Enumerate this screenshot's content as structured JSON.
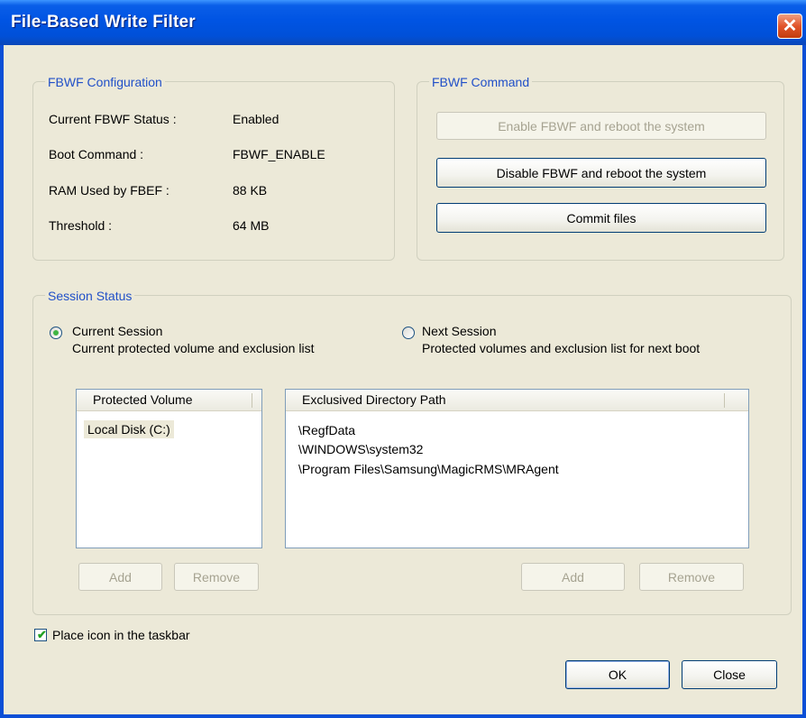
{
  "window": {
    "title": "File-Based Write Filter",
    "close_glyph": "✕"
  },
  "config": {
    "legend": "FBWF Configuration",
    "rows": [
      {
        "label": "Current FBWF Status :",
        "value": "Enabled"
      },
      {
        "label": "Boot Command :",
        "value": "FBWF_ENABLE"
      },
      {
        "label": "RAM Used by FBEF :",
        "value": "88 KB"
      },
      {
        "label": "Threshold :",
        "value": "64 MB"
      }
    ]
  },
  "command": {
    "legend": "FBWF Command",
    "enable_label": "Enable FBWF and reboot the system",
    "disable_label": "Disable FBWF and reboot the system",
    "commit_label": "Commit files"
  },
  "session": {
    "legend": "Session Status",
    "current": {
      "title": "Current Session",
      "desc": "Current  protected volume and exclusion list",
      "selected": true
    },
    "next": {
      "title": "Next Session",
      "desc": "Protected volumes and exclusion list for next boot",
      "selected": false
    },
    "volumes": {
      "header": "Protected Volume",
      "items": [
        "Local Disk (C:)"
      ]
    },
    "exclusions": {
      "header": "Exclusived Directory Path",
      "items": [
        "\\RegfData",
        "\\WINDOWS\\system32",
        "\\Program Files\\Samsung\\MagicRMS\\MRAgent"
      ]
    },
    "add_label": "Add",
    "remove_label": "Remove"
  },
  "footer": {
    "taskbar_label": "Place icon in the taskbar",
    "taskbar_checked": true,
    "check_glyph": "✔",
    "ok_label": "OK",
    "close_label": "Close"
  },
  "colors": {
    "titlebar": "#0054e3",
    "dialog_bg": "#ece9d8",
    "legend_text": "#2150c8",
    "close_button": "#e1542a",
    "radio_dot": "#3fb543",
    "check": "#21a121"
  }
}
